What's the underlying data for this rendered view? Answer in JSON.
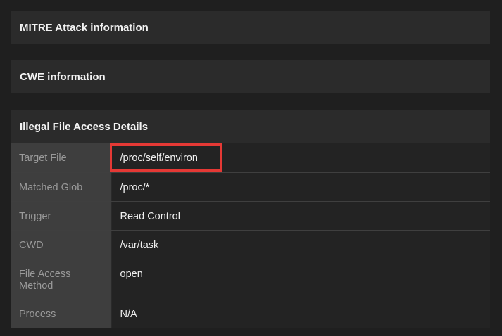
{
  "sections": {
    "mitre": "MITRE Attack information",
    "cwe": "CWE information",
    "illegal_file_access": "Illegal File Access Details"
  },
  "details": [
    {
      "key": "Target File",
      "value": "/proc/self/environ"
    },
    {
      "key": "Matched Glob",
      "value": "/proc/*"
    },
    {
      "key": "Trigger",
      "value": "Read Control"
    },
    {
      "key": "CWD",
      "value": "/var/task"
    },
    {
      "key": "File Access Method",
      "value": "open"
    },
    {
      "key": "Process",
      "value": "N/A"
    }
  ],
  "colors": {
    "highlight": "#e53935"
  }
}
